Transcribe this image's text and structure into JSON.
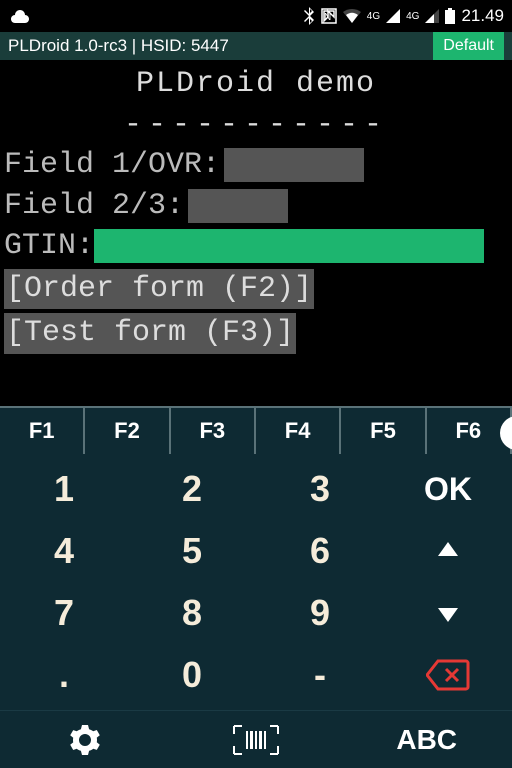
{
  "status": {
    "time": "21.49",
    "net1": "4G",
    "net2": "4G"
  },
  "appbar": {
    "title": "PLDroid 1.0-rc3 | HSID: 5447",
    "profile": "Default"
  },
  "terminal": {
    "title": "PLDroid demo",
    "divider": "-----------",
    "field1_label": "Field 1/OVR:",
    "field2_label": "Field 2/3:",
    "gtin_label": "GTIN:",
    "link1": "[Order form (F2)]",
    "link2": "[Test form (F3)]"
  },
  "fkeys": [
    "F1",
    "F2",
    "F3",
    "F4",
    "F5",
    "F6"
  ],
  "keypad": {
    "k1": "1",
    "k2": "2",
    "k3": "3",
    "ok": "OK",
    "k4": "4",
    "k5": "5",
    "k6": "6",
    "k7": "7",
    "k8": "8",
    "k9": "9",
    "dot": ".",
    "k0": "0",
    "dash": "-"
  },
  "bottom": {
    "mode": "ABC"
  }
}
